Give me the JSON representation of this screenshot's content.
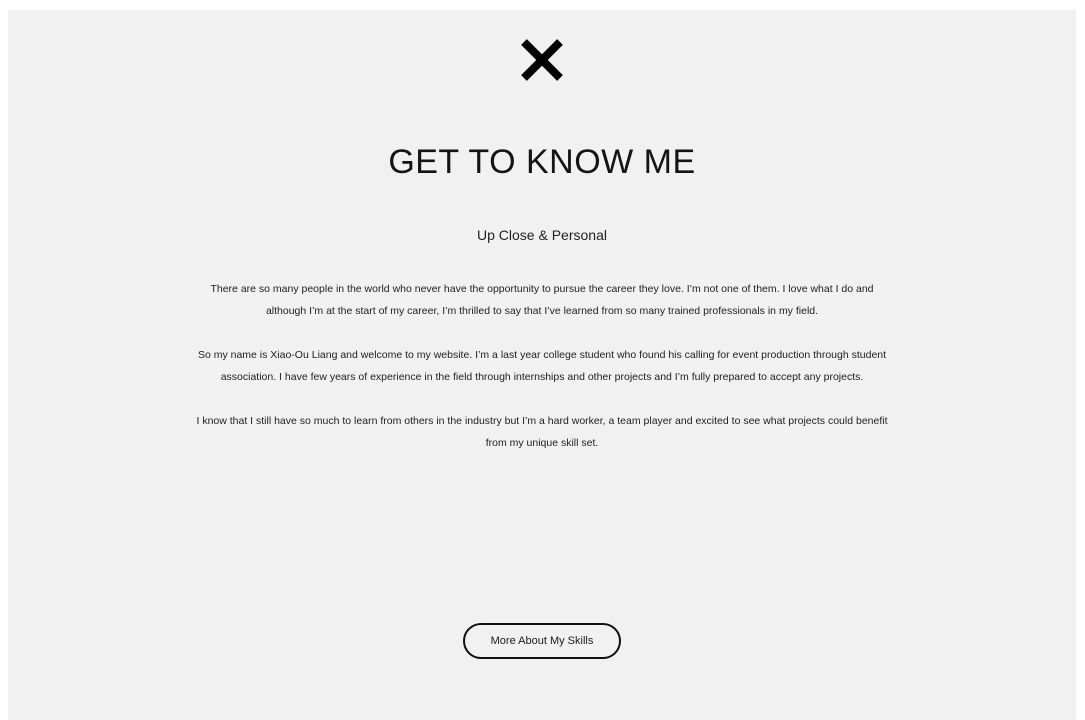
{
  "close_icon": "close-x-icon",
  "heading": {
    "title": "GET TO KNOW ME",
    "subtitle": "Up Close & Personal"
  },
  "body": {
    "paragraphs": [
      "There are so many people in the world who never have the opportunity to pursue the career they love. I’m not one of them. I love what I do and although I’m at the start of my career, I’m thrilled to say that I’ve learned from so many trained professionals in my field.",
      "So my name is Xiao-Ou Liang and welcome to my website. I’m a last year college student who found his calling for event production through student association. I have few years of experience in the field through internships and other projects and I’m fully prepared to accept any projects.",
      "I know that I still have so much to learn from others in the industry but I’m a hard worker, a team player and excited to see what projects could benefit from my unique skill set."
    ]
  },
  "cta": {
    "label": "More About My Skills"
  },
  "colors": {
    "panel_bg": "#f1f1f1",
    "text": "#1a1a1a",
    "button_border": "#111111"
  }
}
